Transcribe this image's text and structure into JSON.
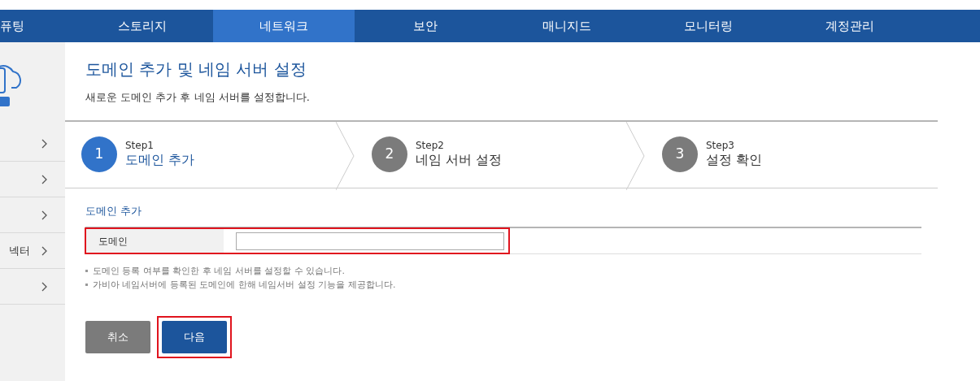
{
  "top_nav": [
    {
      "label": "퓨팅",
      "selected": false
    },
    {
      "label": "스토리지",
      "selected": false
    },
    {
      "label": "네트워크",
      "selected": true
    },
    {
      "label": "보안",
      "selected": false
    },
    {
      "label": "매니지드",
      "selected": false
    },
    {
      "label": "모니터링",
      "selected": false
    },
    {
      "label": "계정관리",
      "selected": false
    }
  ],
  "sidebar": {
    "items": [
      {
        "kind": "arrow"
      },
      {
        "kind": "arrow"
      },
      {
        "kind": "arrow"
      },
      {
        "kind": "labeled",
        "label": "넥터"
      },
      {
        "kind": "arrow"
      }
    ]
  },
  "page": {
    "title": "도메인 추가 및 네임 서버 설정",
    "subtitle": "새로운 도메인 추가 후 네임 서버를 설정합니다."
  },
  "steps": [
    {
      "number": "1",
      "step": "Step1",
      "label": "도메인 추가",
      "selected": true
    },
    {
      "number": "2",
      "step": "Step2",
      "label": "네임 서버 설정",
      "selected": false
    },
    {
      "number": "3",
      "step": "Step3",
      "label": "설정 확인",
      "selected": false
    }
  ],
  "form": {
    "section_title": "도메인 추가",
    "rows": [
      {
        "label": "도메인",
        "highlighted": true
      }
    ],
    "notes": [
      "도메인 등록 여부를 확인한 후 네임 서버를 설정할 수 있습니다.",
      "가비아 네임서버에 등록된 도메인에 한해 네임서버 설정 기능을 제공합니다."
    ]
  },
  "buttons": [
    {
      "label": "취소",
      "kind": "secondary",
      "highlighted": false
    },
    {
      "label": "다음",
      "kind": "primary",
      "highlighted": true
    }
  ]
}
